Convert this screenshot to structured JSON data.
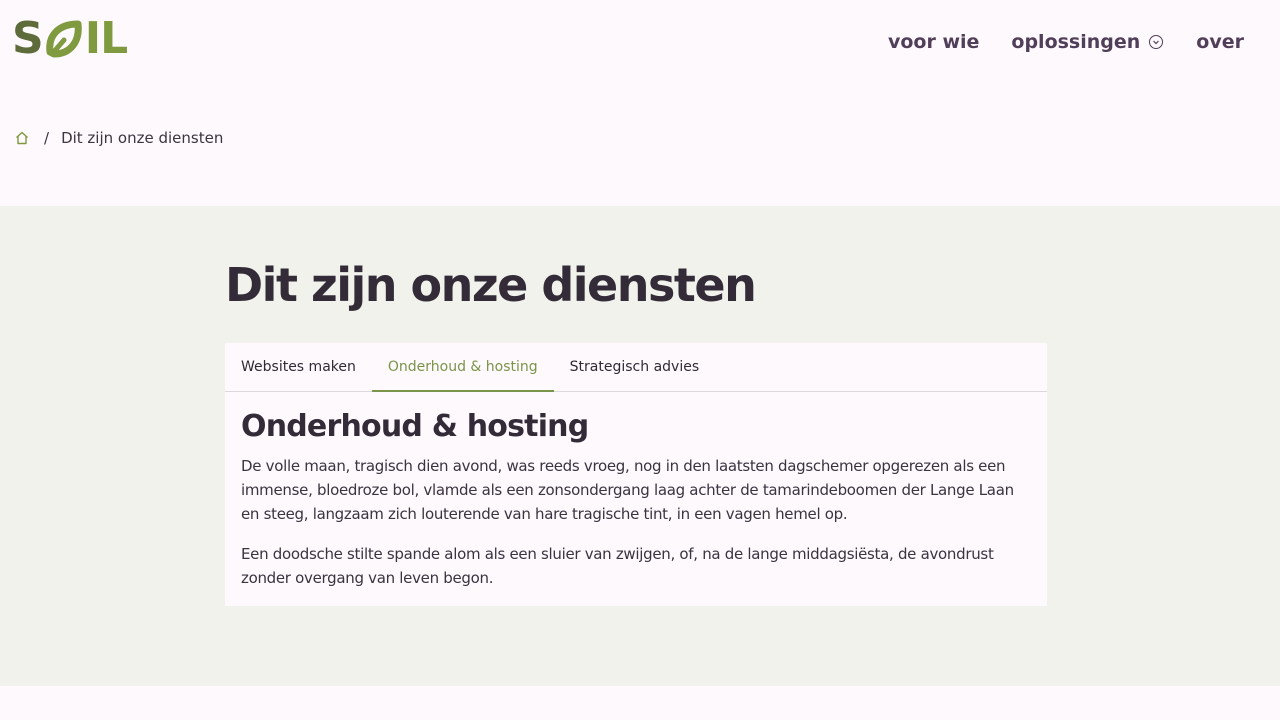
{
  "brand": {
    "logo_text_start": "S",
    "logo_text_end": "IL",
    "primary_color": "#5e6b3a",
    "accent_color": "#7f9a3f",
    "nav_color": "#513f59"
  },
  "nav": {
    "items": [
      {
        "label": "voor wie"
      },
      {
        "label": "oplossingen",
        "icon": "chevron-down-icon"
      },
      {
        "label": "over"
      }
    ]
  },
  "breadcrumb": {
    "home_icon": "home-icon",
    "separator": "/",
    "current": "Dit zijn onze diensten"
  },
  "main": {
    "title": "Dit zijn onze diensten",
    "tabs": [
      {
        "label": "Websites maken",
        "active": false
      },
      {
        "label": "Onderhoud & hosting",
        "active": true
      },
      {
        "label": "Strategisch advies",
        "active": false
      }
    ],
    "panel": {
      "title": "Onderhoud & hosting",
      "paragraphs": [
        "De volle maan, tragisch dien avond, was reeds vroeg, nog in den laatsten dagschemer opgerezen als een immense, bloedroze bol, vlamde als een zonsondergang laag achter de tamarindeboomen der Lange Laan en steeg, langzaam zich louterende van hare tragische tint, in een vagen hemel op.",
        "Een doodsche stilte spande alom als een sluier van zwijgen, of, na de lange middagsiësta, de avondrust zonder overgang van leven begon."
      ]
    }
  }
}
